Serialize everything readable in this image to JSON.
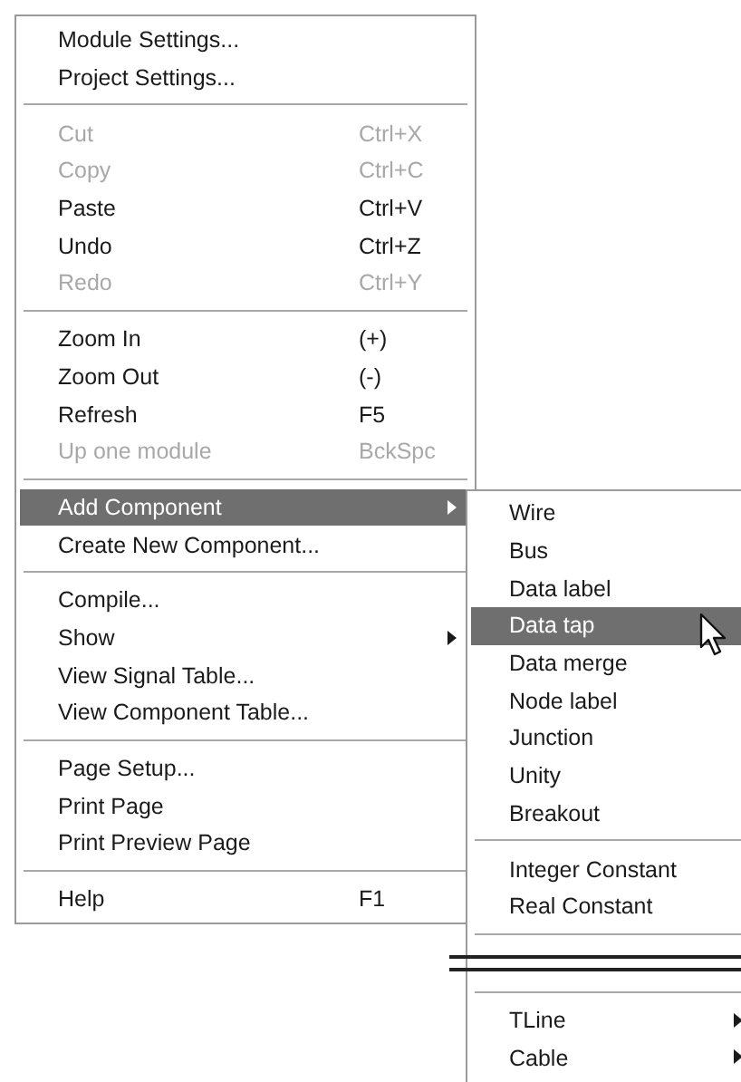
{
  "context_menu": {
    "items": [
      {
        "kind": "item",
        "label": "Module Settings...",
        "disabled": false,
        "selected": false
      },
      {
        "kind": "item",
        "label": "Project Settings...",
        "disabled": false,
        "selected": false
      },
      {
        "kind": "separator"
      },
      {
        "kind": "item",
        "label": "Cut",
        "shortcut": "Ctrl+X",
        "disabled": true,
        "selected": false
      },
      {
        "kind": "item",
        "label": "Copy",
        "shortcut": "Ctrl+C",
        "disabled": true,
        "selected": false
      },
      {
        "kind": "item",
        "label": "Paste",
        "shortcut": "Ctrl+V",
        "disabled": false,
        "selected": false
      },
      {
        "kind": "item",
        "label": "Undo",
        "shortcut": "Ctrl+Z",
        "disabled": false,
        "selected": false
      },
      {
        "kind": "item",
        "label": "Redo",
        "shortcut": "Ctrl+Y",
        "disabled": true,
        "selected": false
      },
      {
        "kind": "separator"
      },
      {
        "kind": "item",
        "label": "Zoom In",
        "shortcut": "(+)",
        "disabled": false,
        "selected": false
      },
      {
        "kind": "item",
        "label": "Zoom Out",
        "shortcut": "(-)",
        "disabled": false,
        "selected": false
      },
      {
        "kind": "item",
        "label": "Refresh",
        "shortcut": "F5",
        "disabled": false,
        "selected": false
      },
      {
        "kind": "item",
        "label": "Up one module",
        "shortcut": "BckSpc",
        "disabled": true,
        "selected": false
      },
      {
        "kind": "separator"
      },
      {
        "kind": "item",
        "label": "Add Component",
        "disabled": false,
        "selected": true,
        "submenu": true
      },
      {
        "kind": "item",
        "label": "Create New Component...",
        "disabled": false,
        "selected": false
      },
      {
        "kind": "separator"
      },
      {
        "kind": "item",
        "label": "Compile...",
        "disabled": false,
        "selected": false
      },
      {
        "kind": "item",
        "label": "Show",
        "disabled": false,
        "selected": false,
        "submenu": true
      },
      {
        "kind": "item",
        "label": "View Signal Table...",
        "disabled": false,
        "selected": false
      },
      {
        "kind": "item",
        "label": "View Component Table...",
        "disabled": false,
        "selected": false
      },
      {
        "kind": "separator"
      },
      {
        "kind": "item",
        "label": "Page Setup...",
        "disabled": false,
        "selected": false
      },
      {
        "kind": "item",
        "label": "Print Page",
        "disabled": false,
        "selected": false
      },
      {
        "kind": "item",
        "label": "Print Preview Page",
        "disabled": false,
        "selected": false
      },
      {
        "kind": "separator"
      },
      {
        "kind": "item",
        "label": "Help",
        "shortcut": "F1",
        "disabled": false,
        "selected": false
      }
    ]
  },
  "submenu": {
    "items": [
      {
        "kind": "item",
        "label": "Wire",
        "disabled": false,
        "selected": false
      },
      {
        "kind": "item",
        "label": "Bus",
        "disabled": false,
        "selected": false
      },
      {
        "kind": "item",
        "label": "Data label",
        "disabled": false,
        "selected": false
      },
      {
        "kind": "item",
        "label": "Data tap",
        "disabled": false,
        "selected": true
      },
      {
        "kind": "item",
        "label": "Data merge",
        "disabled": false,
        "selected": false
      },
      {
        "kind": "item",
        "label": "Node label",
        "disabled": false,
        "selected": false
      },
      {
        "kind": "item",
        "label": "Junction",
        "disabled": false,
        "selected": false
      },
      {
        "kind": "item",
        "label": "Unity",
        "disabled": false,
        "selected": false
      },
      {
        "kind": "item",
        "label": "Breakout",
        "disabled": false,
        "selected": false
      },
      {
        "kind": "separator"
      },
      {
        "kind": "item",
        "label": "Integer Constant",
        "disabled": false,
        "selected": false
      },
      {
        "kind": "item",
        "label": "Real Constant",
        "disabled": false,
        "selected": false
      },
      {
        "kind": "separator"
      },
      {
        "kind": "break"
      },
      {
        "kind": "separator"
      },
      {
        "kind": "item",
        "label": "TLine",
        "disabled": false,
        "selected": false,
        "submenu": true
      },
      {
        "kind": "item",
        "label": "Cable",
        "disabled": false,
        "selected": false,
        "submenu": true
      }
    ]
  }
}
